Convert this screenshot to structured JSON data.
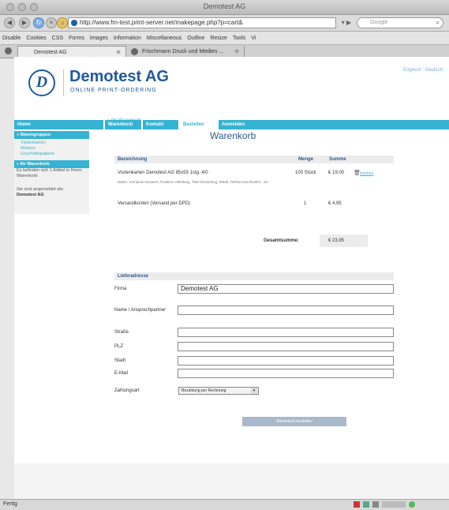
{
  "window": {
    "title": "Demotest AG"
  },
  "nav": {
    "url": "http://www.fm-test.print-server.net/makepage.php?p=cart&",
    "search_placeholder": "Google"
  },
  "bookmarks": [
    "Disable",
    "Cookies",
    "CSS",
    "Forms",
    "Images",
    "Information",
    "Miscellaneous",
    "Outline",
    "Resize",
    "Tools",
    "Vi"
  ],
  "tabs": [
    {
      "label": "Demotest AG"
    },
    {
      "label": "Frischmann Druck und Medien ..."
    }
  ],
  "site": {
    "logo_letter": "D",
    "brand": "Demotest AG",
    "tagline": "ONLINE PRINT-ORDERING",
    "lang": "Englisch · Deutsch",
    "menu": [
      "Home",
      "Warenkorb",
      "Kontakt",
      "Bestellen",
      "Anmelden"
    ],
    "active_menu": "Bestellen"
  },
  "sidebar": {
    "section1": "» Warengruppen",
    "items": [
      "Visitenkarten",
      "Weitere Geschäftspapiere"
    ],
    "section2": "» Ihr Warenkorb",
    "cart_note": "Es befinden sich 1 Artikel in Ihrem Warenkorb",
    "login_note": "Sie sind angemeldet als:",
    "login_user": "Demotest AG"
  },
  "cart": {
    "breadcrumb": "» Ihr Warenkorb",
    "heading": "Warenkorb",
    "columns": {
      "name": "Bezeichnung",
      "qty": "Menge",
      "sum": "Summe"
    },
    "items": [
      {
        "name": "Visitenkarten Demotest AG 85x55 1stg. 4/0",
        "details": "Daten: Vorname+Zuname, Position+Abteilung, Titel+Einstufung, EMail, Telefon-Durchwahl+, 18...",
        "qty": "100 Stück",
        "sum": "€ 19,00",
        "remove": "löschen"
      },
      {
        "name": "Versandkosten (Versand per DPD)",
        "qty": "1",
        "sum": "€ 4,95"
      }
    ],
    "total_label": "Gesamtsumme:",
    "total_value": "€ 23,95"
  },
  "address": {
    "heading": "Lieferadresse",
    "fields": [
      {
        "label": "Firma",
        "value": "Demotest AG"
      },
      {
        "label": "Name / Ansprechpartner",
        "value": ""
      },
      {
        "label": "Straße",
        "value": ""
      },
      {
        "label": "PLZ",
        "value": ""
      },
      {
        "label": "Stadt",
        "value": ""
      },
      {
        "label": "E-Mail",
        "value": ""
      }
    ],
    "payment_label": "Zahlungsart",
    "payment_value": "Bezahlung per Rechnung",
    "submit": "Warenkorb bestellen"
  },
  "status": {
    "left": "Fertig"
  }
}
